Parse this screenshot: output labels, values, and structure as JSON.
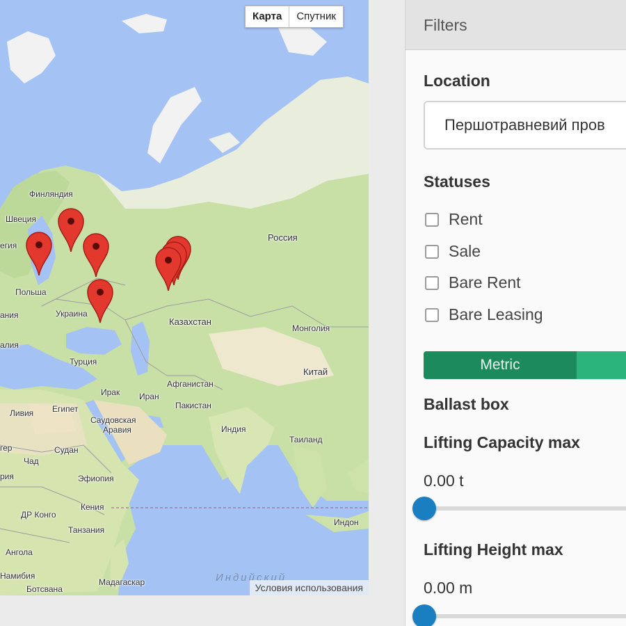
{
  "map": {
    "type_buttons": {
      "map": "Карта",
      "satellite": "Спутник"
    },
    "terms": "Условия использования",
    "labels": {
      "finland": "Финляндия",
      "sweden": "Швеция",
      "norway_partial": "егия",
      "poland": "Польша",
      "ukraine": "Украина",
      "germany_partial": "ания",
      "italy_partial": "алия",
      "russia": "Россия",
      "kazakhstan": "Казахстан",
      "mongolia": "Монголия",
      "china": "Китай",
      "turkey": "Турция",
      "iraq": "Ирак",
      "iran": "Иран",
      "afghanistan": "Афганистан",
      "pakistan": "Пакистан",
      "india": "Индия",
      "thailand": "Таиланд",
      "libya": "Ливия",
      "egypt": "Египет",
      "saudi_arabia_1": "Саудовская",
      "saudi_arabia_2": "Аравия",
      "sudan": "Судан",
      "chad": "Чад",
      "niger_partial": "гер",
      "nigeria_partial": "рия",
      "ethiopia": "Эфиопия",
      "kenya": "Кения",
      "dr_congo": "ДР Конго",
      "tanzania": "Танзания",
      "angola": "Ангола",
      "namibia": "Намибия",
      "botswana": "Ботсвана",
      "madagascar": "Мадагаскар",
      "indonesia_partial": "Индон",
      "indian_ocean": "Индийский"
    }
  },
  "filters": {
    "header": "Filters",
    "location_title": "Location",
    "location_value": "Першотравневий пров",
    "statuses_title": "Statuses",
    "statuses": [
      {
        "label": "Rent",
        "checked": false
      },
      {
        "label": "Sale",
        "checked": false
      },
      {
        "label": "Bare Rent",
        "checked": false
      },
      {
        "label": "Bare Leasing",
        "checked": false
      }
    ],
    "units": {
      "active": "Metric"
    },
    "ballast_title": "Ballast box",
    "lifting_capacity": {
      "title": "Lifting Capacity max",
      "value": "0.00 t",
      "fraction": 0
    },
    "lifting_height": {
      "title": "Lifting Height max",
      "value": "0.00 m",
      "fraction": 0
    }
  },
  "colors": {
    "accent_green_dark": "#1c8a5c",
    "accent_green": "#2bb47b",
    "slider_blue": "#1a7fc1",
    "pin_red": "#e2382e"
  }
}
